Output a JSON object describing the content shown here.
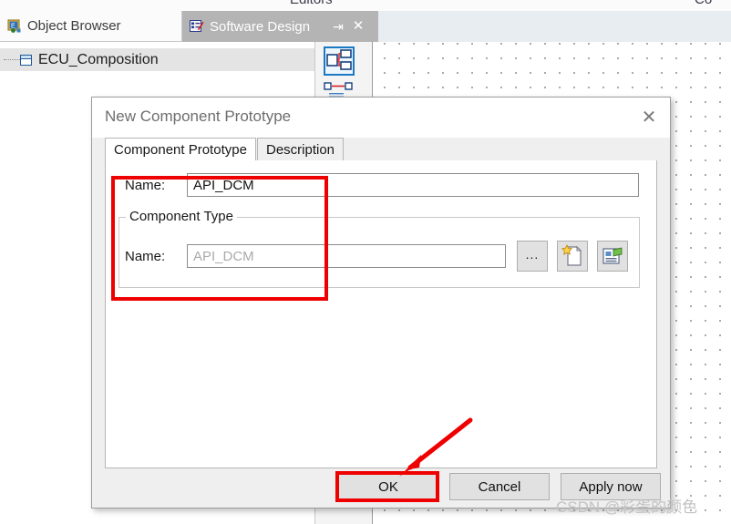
{
  "app": {
    "menu_partial_left": "Editors",
    "menu_partial_right": "Co"
  },
  "tabs": [
    {
      "label": "Object Browser",
      "icon": "object-browser-icon",
      "active": false
    },
    {
      "label": "Software Design",
      "icon": "software-design-icon",
      "active": true
    }
  ],
  "tab_controls": {
    "pin": "⇥",
    "close": "✕"
  },
  "tree": {
    "items": [
      {
        "label": "ECU_Composition",
        "icon": "composition-node-icon",
        "selected": true
      }
    ]
  },
  "toolbox": {
    "items": [
      {
        "name": "component-tool",
        "selected": true
      },
      {
        "name": "connector-tool",
        "selected": false
      }
    ]
  },
  "dialog": {
    "title": "New Component Prototype",
    "close_label": "✕",
    "tabs": [
      {
        "label": "Component Prototype",
        "active": true
      },
      {
        "label": "Description",
        "active": false
      }
    ],
    "prototype": {
      "name_label": "Name:",
      "name_value": "API_DCM"
    },
    "component_type": {
      "group_label": "Component Type",
      "name_label": "Name:",
      "name_value": "",
      "name_placeholder": "API_DCM",
      "browse_label": "...",
      "new_button_name": "new-type-button",
      "edit_button_name": "edit-type-button"
    },
    "buttons": {
      "ok": "OK",
      "cancel": "Cancel",
      "apply": "Apply now"
    }
  },
  "annotations": {
    "highlight_color": "#ee0000",
    "boxes": [
      "name-fields-highlight",
      "ok-button-highlight"
    ],
    "arrow": "arrow-pointing-to-ok"
  },
  "watermark": "CSDN @彩蛋的颜色"
}
